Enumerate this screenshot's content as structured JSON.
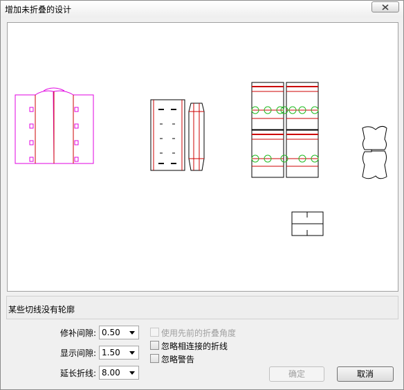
{
  "window": {
    "title": "增加未折叠的设计"
  },
  "status": {
    "message": "某些切线没有轮廓"
  },
  "fields": [
    {
      "label": "修补间隙:",
      "value": "0.50"
    },
    {
      "label": "显示间隙:",
      "value": "1.50"
    },
    {
      "label": "延长折线:",
      "value": "8.00"
    }
  ],
  "options": [
    {
      "label": "使用先前的折叠角度",
      "checked": false,
      "enabled": false
    },
    {
      "label": "忽略相连接的折线",
      "checked": false,
      "enabled": true
    },
    {
      "label": "忽略警告",
      "checked": false,
      "enabled": true
    }
  ],
  "buttons": {
    "ok": "确定",
    "cancel": "取消"
  },
  "colors": {
    "cut": "#cc0000",
    "outline": "#000000",
    "magenta": "#e000e0",
    "green": "#22bb22"
  },
  "icons": {
    "close": "close-icon"
  }
}
